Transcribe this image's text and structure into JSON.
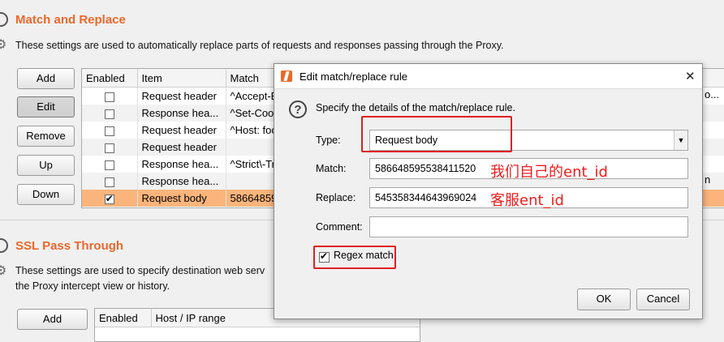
{
  "match_replace": {
    "title": "Match and Replace",
    "description": "These settings are used to automatically replace parts of requests and responses passing through the Proxy.",
    "buttons": {
      "add": "Add",
      "edit": "Edit",
      "remove": "Remove",
      "up": "Up",
      "down": "Down"
    },
    "columns": [
      "Enabled",
      "Item",
      "Match"
    ],
    "rows": [
      {
        "enabled": false,
        "item": "Request header",
        "match": "^Accept-E"
      },
      {
        "enabled": false,
        "item": "Response hea...",
        "match": "^Set-Cool"
      },
      {
        "enabled": false,
        "item": "Request header",
        "match": "^Host: foo"
      },
      {
        "enabled": false,
        "item": "Request header",
        "match": ""
      },
      {
        "enabled": false,
        "item": "Response hea...",
        "match": "^Strict\\-Tr"
      },
      {
        "enabled": false,
        "item": "Response hea...",
        "match": ""
      },
      {
        "enabled": true,
        "item": "Request body",
        "match": "58664859"
      }
    ],
    "right_fragments": {
      "row1": "o...",
      "row6": "n"
    }
  },
  "ssl_pass_through": {
    "title": "SSL Pass Through",
    "description_line1": "These settings are used to specify destination web serv",
    "description_line2": "the Proxy intercept view or history.",
    "add_label": "Add",
    "columns": [
      "Enabled",
      "Host / IP range"
    ]
  },
  "dialog": {
    "title": "Edit match/replace rule",
    "close_symbol": "✕",
    "help_text": "Specify the details of the match/replace rule.",
    "type_label": "Type:",
    "type_value": "Request body",
    "match_label": "Match:",
    "match_value": "586648595538411520",
    "replace_label": "Replace:",
    "replace_value": "545358344643969024",
    "comment_label": "Comment:",
    "comment_value": "",
    "regex_label": "Regex match",
    "regex_checked": true,
    "ok_label": "OK",
    "cancel_label": "Cancel"
  },
  "annotations": {
    "match_note": "我们自己的ent_id",
    "replace_note": "客服ent_id"
  },
  "colors": {
    "accent": "#e8692a",
    "selected_row": "#fbb57c",
    "annotation_red": "#e02020"
  }
}
